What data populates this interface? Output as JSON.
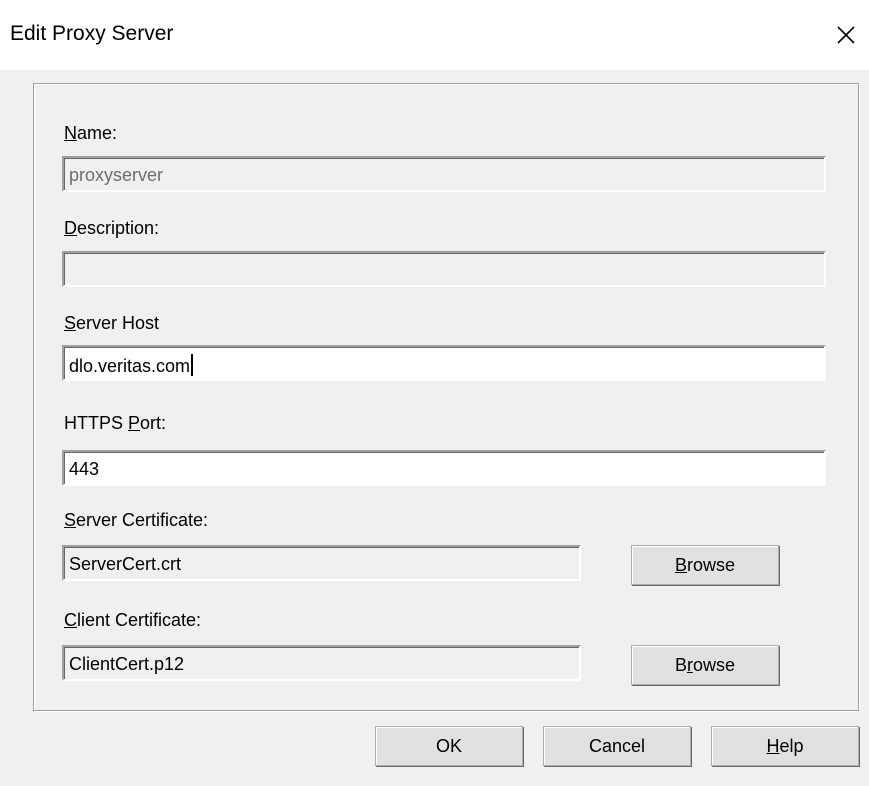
{
  "window": {
    "title": "Edit Proxy Server",
    "close_symbol": "✕"
  },
  "form": {
    "name": {
      "label_prefix": "",
      "label_key": "N",
      "label_rest": "ame:",
      "value": "proxyserver"
    },
    "description": {
      "label_prefix": "",
      "label_key": "D",
      "label_rest": "escription:",
      "value": ""
    },
    "server_host": {
      "label_prefix": "",
      "label_key": "S",
      "label_rest": "erver Host",
      "value": "dlo.veritas.com"
    },
    "https_port": {
      "label_prefix": "HTTPS ",
      "label_key": "P",
      "label_rest": "ort:",
      "value": "443"
    },
    "server_certificate": {
      "label_prefix": "",
      "label_key": "S",
      "label_rest": "erver Certificate:",
      "value": "ServerCert.crt",
      "browse_prefix": "",
      "browse_key": "B",
      "browse_rest": "rowse"
    },
    "client_certificate": {
      "label_prefix": "",
      "label_key": "C",
      "label_rest": "lient Certificate:",
      "value": "ClientCert.p12",
      "browse_prefix": "B",
      "browse_key": "r",
      "browse_rest": "owse"
    }
  },
  "buttons": {
    "ok": "OK",
    "cancel": "Cancel",
    "help_key": "H",
    "help_rest": "elp"
  },
  "icons": {
    "close": "close-icon"
  }
}
